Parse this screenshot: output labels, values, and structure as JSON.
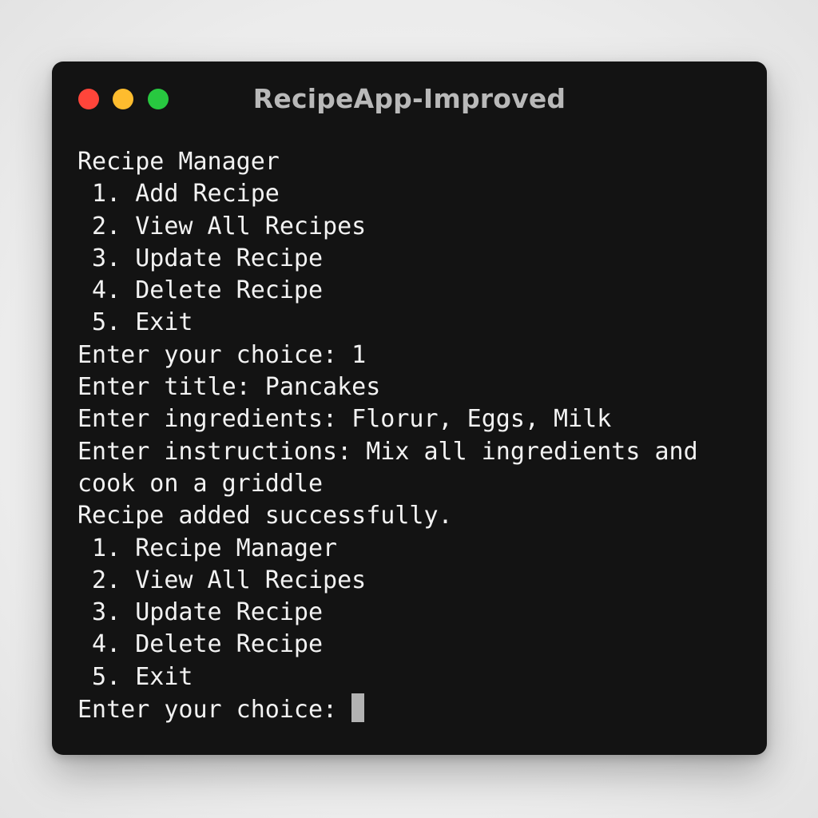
{
  "window": {
    "title": "RecipeApp-Improved"
  },
  "colors": {
    "background": "#131313",
    "text": "#f2f2f2",
    "title": "#b9b9b9",
    "close": "#ff453a",
    "minimize": "#febc2e",
    "zoom": "#28c840",
    "cursor": "#b3b3b3"
  },
  "terminal": {
    "lines": [
      "Recipe Manager",
      " 1. Add Recipe",
      " 2. View All Recipes",
      " 3. Update Recipe",
      " 4. Delete Recipe",
      " 5. Exit",
      "Enter your choice: 1",
      "Enter title: Pancakes",
      "Enter ingredients: Florur, Eggs, Milk",
      "Enter instructions: Mix all ingredients and",
      "cook on a griddle",
      "Recipe added successfully.",
      " 1. Recipe Manager",
      " 2. View All Recipes",
      " 3. Update Recipe",
      " 4. Delete Recipe",
      " 5. Exit"
    ],
    "prompt": "Enter your choice: "
  }
}
